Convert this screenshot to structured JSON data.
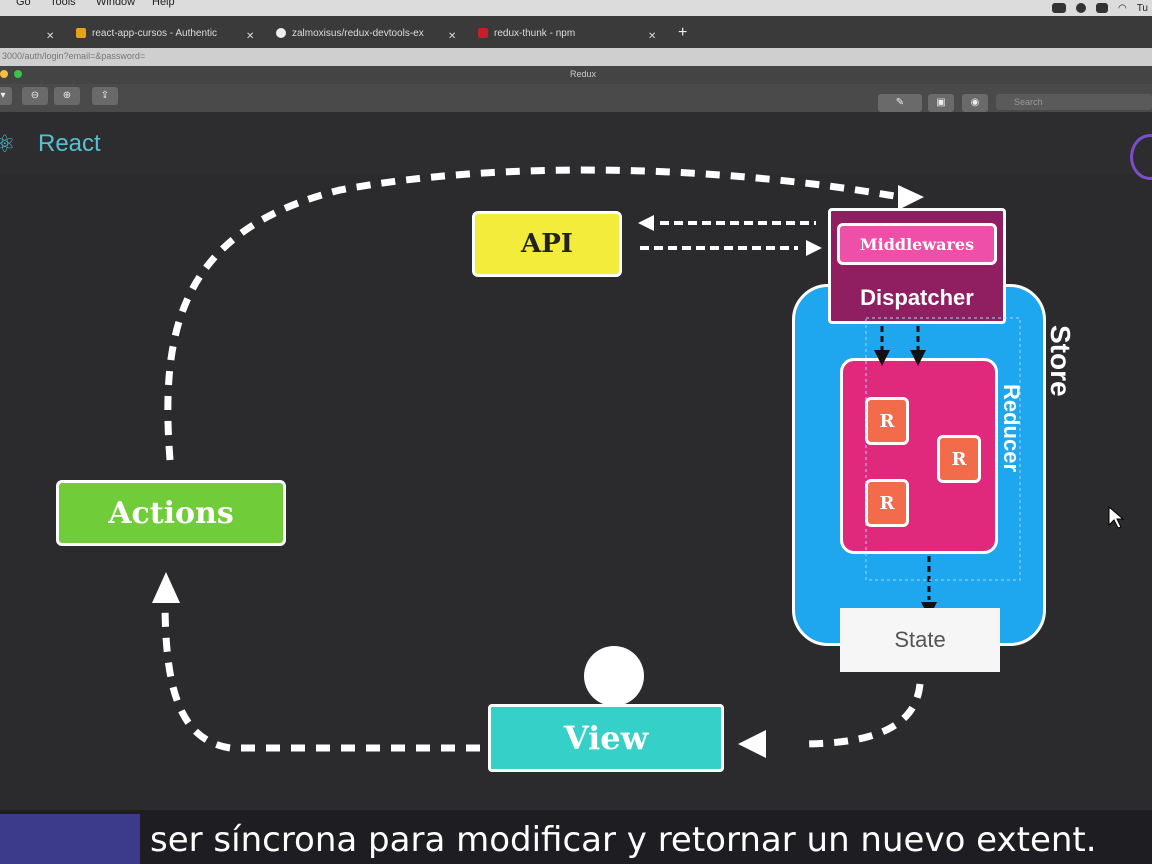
{
  "os_menu": [
    "Go",
    "Tools",
    "Window",
    "Help"
  ],
  "status_bar": {
    "user_text": "Tu"
  },
  "tabs": [
    {
      "label": "react-app-cursos - Authentic",
      "color": "#e6a21b"
    },
    {
      "label": "zalmoxisus/redux-devtools-ex",
      "color": "#eeeeee"
    },
    {
      "label": "redux-thunk - npm",
      "color": "#c12127"
    }
  ],
  "url": "3000/auth/login?email=&password=",
  "app_title": "Redux",
  "search_placeholder": "Search",
  "slide": {
    "brand": "React",
    "diagram": {
      "api": "API",
      "middlewares": "Middlewares",
      "dispatcher": "Dispatcher",
      "store": "Store",
      "reducer": "Reducer",
      "reducer_items": [
        "R",
        "R",
        "R"
      ],
      "state": "State",
      "actions": "Actions",
      "view": "View"
    }
  },
  "subtitle": "ser síncrona para modificar y retornar un nuevo extent.",
  "colors": {
    "api": "#f4ec3b",
    "actions": "#71cc3a",
    "view": "#35d0c7",
    "store": "#1ea7ee",
    "dispatcher": "#8f1f61",
    "middlewares": "#ee4fa8",
    "reducer": "#e0297c",
    "reducer_item": "#f26b4a"
  }
}
